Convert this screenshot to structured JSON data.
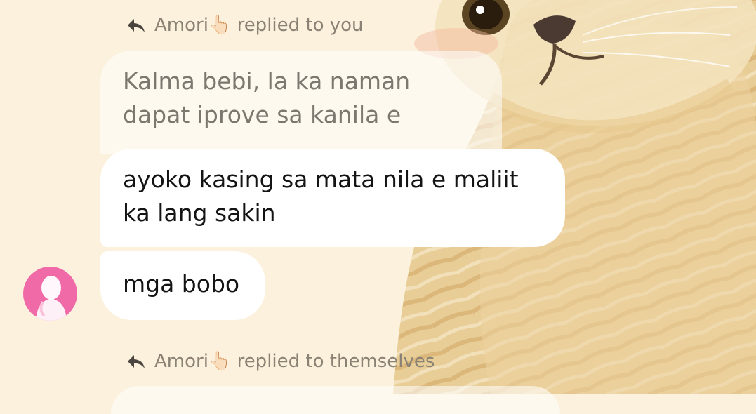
{
  "background": {
    "icon": "cat-wallpaper",
    "color": "#fbf1dc"
  },
  "thread": {
    "reply_header_1": {
      "icon": "reply-arrow-icon",
      "text": "Amori👆🏻 replied to you"
    },
    "quoted_message": {
      "text": "Kalma bebi, la ka naman dapat iprove sa kanila e"
    },
    "messages": [
      {
        "text": "ayoko kasing sa mata nila e maliit ka lang sakin"
      },
      {
        "text": "mga bobo"
      }
    ],
    "sender_avatar": {
      "icon": "profile-avatar-pink"
    },
    "reply_header_2": {
      "icon": "reply-arrow-icon",
      "text": "Amori👆🏻 replied to themselves"
    }
  },
  "colors": {
    "bubble": "#ffffff",
    "quoted_bubble": "rgba(255,255,255,0.55)",
    "header_text": "#8a8275",
    "avatar_pink": "#f06aa8"
  }
}
